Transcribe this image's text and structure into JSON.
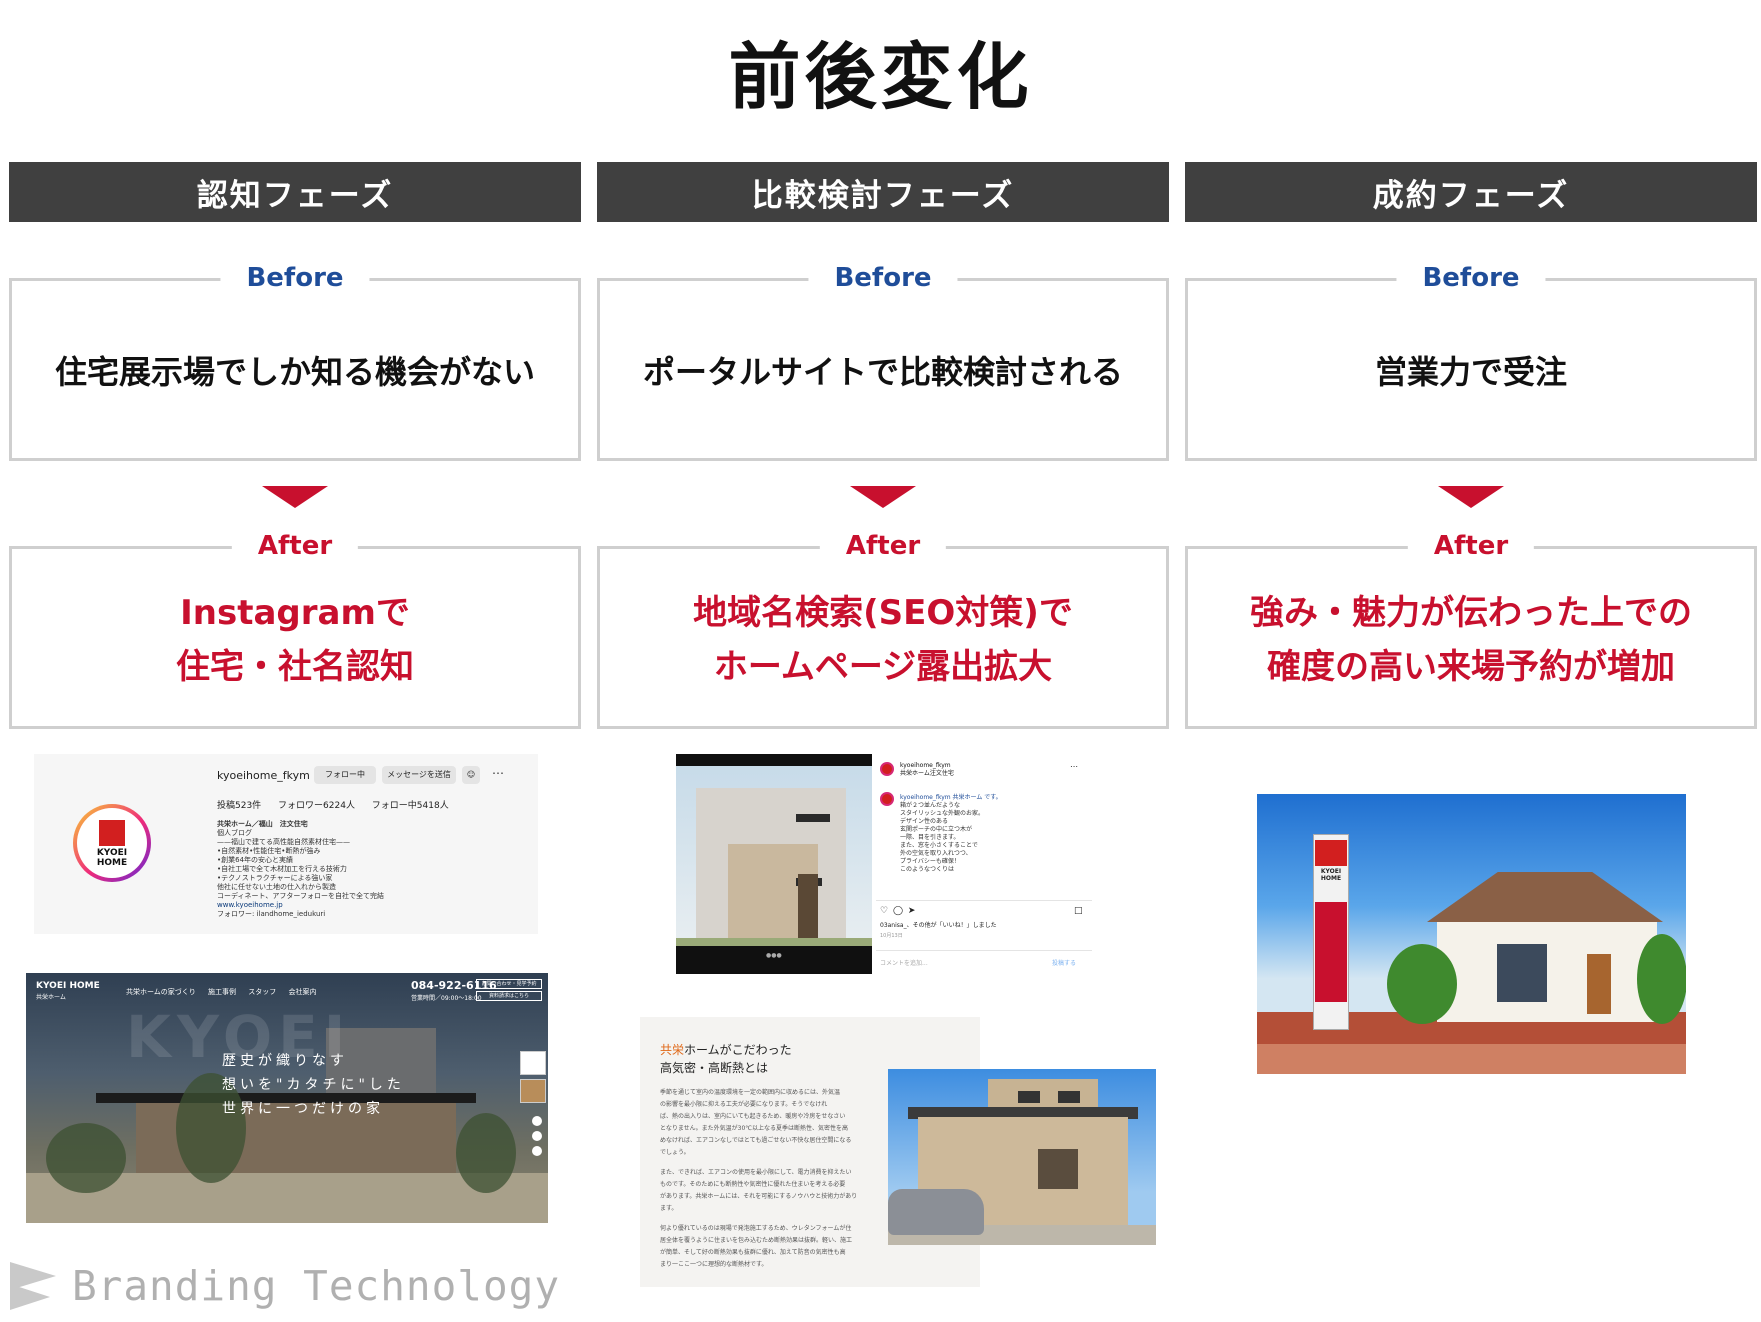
{
  "title": "前後変化",
  "labels": {
    "before": "Before",
    "after": "After"
  },
  "colors": {
    "header_bg": "#404040",
    "before_label": "#1f4d99",
    "after_accent": "#c8102e",
    "box_border": "#cfcfcf"
  },
  "phases": [
    {
      "name": "認知フェーズ",
      "before": "住宅展示場でしか知る機会がない",
      "after": [
        "Instagramで",
        "住宅・社名認知"
      ]
    },
    {
      "name": "比較検討フェーズ",
      "before": "ポータルサイトで比較検討される",
      "after": [
        "地域名検索(SEO対策)で",
        "ホームページ露出拡大"
      ]
    },
    {
      "name": "成約フェーズ",
      "before": "営業力で受注",
      "after": [
        "強み・魅力が伝わった上での",
        "確度の高い来場予約が増加"
      ]
    }
  ],
  "instagram_profile": {
    "username": "kyoeihome_fkym",
    "follow_button": "フォロー中",
    "message_button": "メッセージを送信",
    "stats": "投稿523件 フォロワー6224人 フォロー中5418人",
    "logo_text": "KYOEI HOME",
    "bio": [
      "共栄ホーム／福山　注文住宅",
      "個人ブログ",
      "——福山で建てる高性能自然素材住宅——",
      "•自然素材•性能住宅•断熱が強み",
      "•創業64年の安心と実績",
      "•自社工場で全て木材加工を行える技術力",
      "•テクノストラクチャーによる強い家",
      "他社に任せない土地の仕入れから製造",
      "コーディネート、アフターフォローを自社で全て完結"
    ],
    "link": "www.kyoeihome.jp",
    "followed_by": "フォロワー: ilandhome_iedukuri"
  },
  "website": {
    "brand": "KYOEI HOME",
    "brand_sub": "共栄ホーム",
    "nav": "共栄ホームの家づくり 施工事例 スタッフ 会社案内",
    "phone": "084-922-6116",
    "hours": "営業時間／09:00～18:00",
    "btn_contact": "お問い合わせ・見学予約",
    "btn_catalog": "資料請求はこちら",
    "watermark": "KYOEI",
    "tagline": [
      "歴史が織りなす",
      "想いを\"カタチに\"した",
      "世界に一つだけの家"
    ]
  },
  "instagram_post": {
    "username": "kyoeihome_fkym",
    "location": "共栄ホーム注文住宅",
    "caption": [
      "kyoeihome_fkym 共栄ホーム です。",
      "箱が２つ並んだような",
      "スタイリッシュな外観のお家。",
      "",
      "デザイン性のある",
      "玄関ポーチの中に立つ木が",
      "一際、目を引きます。",
      "",
      "また、窓を小さくすることで",
      "外の空気を取り入れつつ、",
      "プライバシーも確保！",
      "",
      "このようなつくりは"
    ],
    "likes": "03anisa_、その他が「いいね！」しました",
    "date": "10月13日",
    "comment_placeholder": "コメントを追加...",
    "post_button": "投稿する"
  },
  "article": {
    "heading_accent": "共栄",
    "heading_line1_rest": "ホームがこだわった",
    "heading_line2": "高気密・高断熱とは",
    "para1": [
      "季節を通じて室内の温度環境を一定の範囲内に収めるには、外気温",
      "の影響を最小限に抑える工夫が必要になります。そうでなけれ",
      "ば、熱の出入りは、室内にいても起きるため、暖房や冷房をせなさい",
      "となりません。また外気温が30℃以上なる夏季は断熱性、気密性を高",
      "めなければ、エアコンなしではとても過ごせない不快な居住空間になる",
      "でしょう。"
    ],
    "para2": [
      "また、できれば、エアコンの使用を最小限にして、電力消費を抑えたい",
      "ものです。そのためにも断熱性や気密性に優れた住まいを考える必要",
      "があります。共栄ホームには、それを可能にするノウハウと技術力があり",
      "ます。"
    ],
    "para3": [
      "何より優れているのは現場で発泡施工するため、ウレタンフォームが住",
      "居全体を覆うように住まいを包み込むため断熱効果は抜群。軽い、施工",
      "が簡単、そして好の断熱効果も抜群に優れ、加えて防音の気密性も高",
      "まり一ここ一つに理想的な断熱材です。"
    ]
  },
  "model_house": {
    "sign_text": "KYOEI HOME"
  },
  "footer": {
    "brand": "Branding Technology"
  }
}
